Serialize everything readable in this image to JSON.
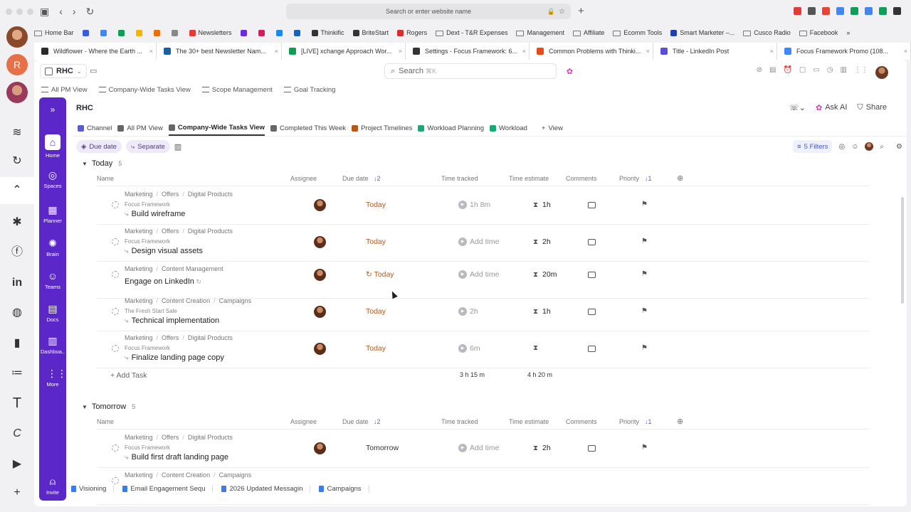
{
  "browser": {
    "url_placeholder": "Search or enter website name"
  },
  "bookmarks": [
    {
      "label": "Home Bar",
      "kind": "folder"
    },
    {
      "label": "",
      "kind": "icon",
      "color": "#3b5bdb"
    },
    {
      "label": "",
      "kind": "icon",
      "color": "#4285f4"
    },
    {
      "label": "",
      "kind": "icon",
      "color": "#0f9d58"
    },
    {
      "label": "",
      "kind": "icon",
      "color": "#f4b400"
    },
    {
      "label": "",
      "kind": "icon",
      "color": "#e8710a"
    },
    {
      "label": "",
      "kind": "icon",
      "color": "#888888"
    },
    {
      "label": "Newsletters",
      "kind": "icon",
      "color": "#e53935"
    },
    {
      "label": "",
      "kind": "icon",
      "color": "#6c2bd9"
    },
    {
      "label": "",
      "kind": "icon",
      "color": "#d81b60"
    },
    {
      "label": "",
      "kind": "icon",
      "color": "#1e88e5"
    },
    {
      "label": "",
      "kind": "icon",
      "color": "#1565c0"
    },
    {
      "label": "Thinkific",
      "kind": "icon",
      "color": "#333333"
    },
    {
      "label": "BriteStart",
      "kind": "icon",
      "color": "#333333"
    },
    {
      "label": "Rogers",
      "kind": "icon",
      "color": "#d32f2f"
    },
    {
      "label": "Dext - T&R Expenses",
      "kind": "folder"
    },
    {
      "label": "Management",
      "kind": "folder"
    },
    {
      "label": "Affiliate",
      "kind": "folder"
    },
    {
      "label": "Ecomm Tools",
      "kind": "folder"
    },
    {
      "label": "Smart Marketer –...",
      "kind": "icon",
      "color": "#1e40af"
    },
    {
      "label": "Cusco Radio",
      "kind": "folder"
    },
    {
      "label": "Facebook",
      "kind": "folder"
    }
  ],
  "tabs": [
    {
      "label": "Wildflower - Where the Earth ...",
      "color": "#2b2b2b",
      "width": 172
    },
    {
      "label": "The 30+ best Newsletter Nam...",
      "color": "#1a5fa8",
      "width": 176
    },
    {
      "label": "[LIVE] xchange Approach Wor...",
      "color": "#0f9d58",
      "width": 174
    },
    {
      "label": "Settings - Focus Framework: 6...",
      "color": "#333333",
      "width": 174
    },
    {
      "label": "Common Problems with Thinki...",
      "color": "#e64a19",
      "width": 174
    },
    {
      "label": "Title - LinkedIn Post",
      "color": "#5b4ed8",
      "width": 174
    },
    {
      "label": "Focus Framework Promo (108...",
      "color": "#4285f4",
      "width": 188
    }
  ],
  "workspace": {
    "name": "RHC",
    "search": "Search",
    "search_shortcut": "⌘K"
  },
  "favorites": [
    {
      "label": "All PM View"
    },
    {
      "label": "Company-Wide Tasks View"
    },
    {
      "label": "Scope Management"
    },
    {
      "label": "Goal Tracking"
    }
  ],
  "sidebar": [
    {
      "label": "Home",
      "icon": "home-icon",
      "glyph": "⌂"
    },
    {
      "label": "Spaces",
      "icon": "planet-icon",
      "glyph": "◎"
    },
    {
      "label": "Planner",
      "icon": "calendar-icon",
      "glyph": "▦"
    },
    {
      "label": "Brain",
      "icon": "brain-icon",
      "glyph": "✺"
    },
    {
      "label": "Teams",
      "icon": "teams-icon",
      "glyph": "☺"
    },
    {
      "label": "Docs",
      "icon": "docs-icon",
      "glyph": "▤"
    },
    {
      "label": "Dashboa..",
      "icon": "dashboard-icon",
      "glyph": "▥"
    },
    {
      "label": "More",
      "icon": "grid-icon",
      "glyph": "⋮⋮"
    },
    {
      "label": "Invite",
      "icon": "invite-icon",
      "glyph": "⍝"
    }
  ],
  "page": {
    "title": "RHC",
    "ask_ai": "Ask AI",
    "share": "Share",
    "views": [
      {
        "label": "Channel",
        "color": "#5b5bd6",
        "active": false
      },
      {
        "label": "All PM View",
        "color": "#666666",
        "active": false
      },
      {
        "label": "Company-Wide Tasks View",
        "color": "#666666",
        "active": true
      },
      {
        "label": "Completed This Week",
        "color": "#666666",
        "active": false
      },
      {
        "label": "Project Timelines",
        "color": "#b5591a",
        "active": false
      },
      {
        "label": "Workload Planning",
        "color": "#19a974",
        "active": false
      },
      {
        "label": "Workload",
        "color": "#19a974",
        "active": false
      },
      {
        "label": "View",
        "color": "#666666",
        "active": false
      }
    ],
    "chips": [
      "Due date",
      "Separate"
    ],
    "filters": "5 Filters"
  },
  "columns": {
    "name": "Name",
    "assignee": "Assignee",
    "due": "Due date",
    "due_sort": "↓2",
    "tracked": "Time tracked",
    "estimate": "Time estimate",
    "comments": "Comments",
    "priority": "Priority",
    "priority_sort": "↓1"
  },
  "groups": [
    {
      "title": "Today",
      "count": "5",
      "add": "Add Task",
      "sum_tracked": "3 h 15 m",
      "sum_estimate": "4 h 20 m",
      "tasks": [
        {
          "path": [
            "Marketing",
            "Offers",
            "Digital Products"
          ],
          "parent": "Focus Framework",
          "name": "Build wireframe",
          "due": "Today",
          "tracked": "1h 8m",
          "estimate": "1h",
          "sub": true,
          "recur": false
        },
        {
          "path": [
            "Marketing",
            "Offers",
            "Digital Products"
          ],
          "parent": "Focus Framework",
          "name": "Design visual assets",
          "due": "Today",
          "tracked": "Add time",
          "estimate": "2h",
          "sub": true,
          "recur": false
        },
        {
          "path": [
            "Marketing",
            "Content Management"
          ],
          "parent": "",
          "name": "Engage on LinkedIn",
          "due": "Today",
          "tracked": "Add time",
          "estimate": "20m",
          "sub": false,
          "recur": true
        },
        {
          "path": [
            "Marketing",
            "Content Creation",
            "Campaigns"
          ],
          "parent": "The Fresh Start Sale",
          "name": "Technical implementation",
          "due": "Today",
          "tracked": "2h",
          "estimate": "1h",
          "sub": true,
          "recur": false
        },
        {
          "path": [
            "Marketing",
            "Offers",
            "Digital Products"
          ],
          "parent": "Focus Framework",
          "name": "Finalize landing page copy",
          "due": "Today",
          "tracked": "6m",
          "estimate": "",
          "sub": true,
          "recur": false
        }
      ]
    },
    {
      "title": "Tomorrow",
      "count": "5",
      "tasks": [
        {
          "path": [
            "Marketing",
            "Offers",
            "Digital Products"
          ],
          "parent": "Focus Framework",
          "name": "Build first draft landing page",
          "due": "Tomorrow",
          "tracked": "Add time",
          "estimate": "2h",
          "sub": true,
          "recur": false
        },
        {
          "path": [
            "Marketing",
            "Content Creation",
            "Campaigns"
          ],
          "parent": "",
          "name": "",
          "due": "",
          "tracked": "",
          "estimate": "",
          "sub": false,
          "recur": false
        }
      ]
    }
  ],
  "docbar": [
    "Visioning",
    "Email Engagement Sequ",
    "2026 Updated Messagin",
    "Campaigns"
  ]
}
